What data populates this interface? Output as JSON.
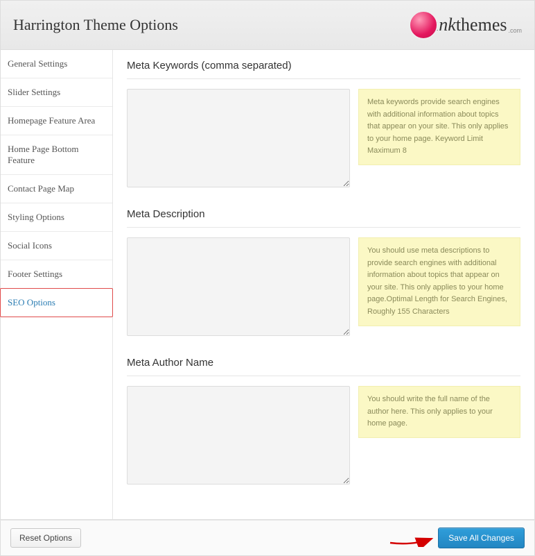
{
  "header": {
    "title": "Harrington Theme Options",
    "logo_text_a": "ınk",
    "logo_text_b": "themes",
    "logo_com": ".com"
  },
  "sidebar": {
    "items": [
      {
        "label": "General Settings"
      },
      {
        "label": "Slider Settings"
      },
      {
        "label": "Homepage Feature Area"
      },
      {
        "label": "Home Page Bottom Feature"
      },
      {
        "label": "Contact Page Map"
      },
      {
        "label": "Styling Options"
      },
      {
        "label": "Social Icons"
      },
      {
        "label": "Footer Settings"
      },
      {
        "label": "SEO Options"
      }
    ],
    "active_index": 8
  },
  "sections": [
    {
      "title": "Meta Keywords (comma separated)",
      "value": "",
      "help": "Meta keywords provide search engines with additional information about topics that appear on your site. This only applies to your home page. Keyword Limit Maximum 8"
    },
    {
      "title": "Meta Description",
      "value": "",
      "help": "You should use meta descriptions to provide search engines with additional information about topics that appear on your site. This only applies to your home page.Optimal Length for Search Engines, Roughly 155 Characters"
    },
    {
      "title": "Meta Author Name",
      "value": "",
      "help": "You should write the full name of the author here. This only applies to your home page."
    }
  ],
  "footer": {
    "reset": "Reset Options",
    "save": "Save All Changes"
  }
}
